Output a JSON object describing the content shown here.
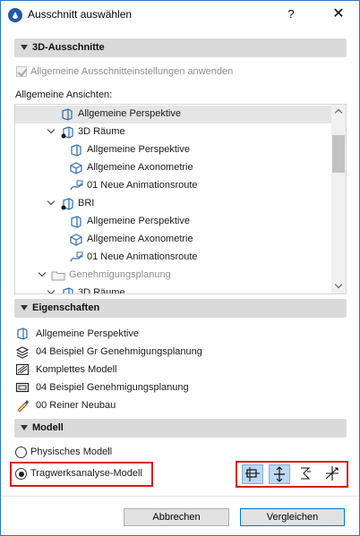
{
  "window": {
    "title": "Ausschnitt auswählen",
    "help_label": "?",
    "close_label": "✕"
  },
  "section_3d": {
    "label": "3D-Ausschnitte"
  },
  "apply_general": {
    "label": "Allgemeine Ausschnitteinstellungen anwenden",
    "checked": true,
    "disabled": true
  },
  "views_label": "Allgemeine Ansichten:",
  "tree": [
    {
      "label": "Allgemeine Perspektive",
      "icon": "perspective-icon",
      "selected": true
    },
    {
      "label": "3D Räume",
      "icon": "folder-3d-icon",
      "expanded": true
    },
    {
      "label": "Allgemeine Perspektive",
      "icon": "perspective-icon"
    },
    {
      "label": "Allgemeine Axonometrie",
      "icon": "axonometry-icon"
    },
    {
      "label": "01 Neue Animationsroute",
      "icon": "animation-route-icon"
    },
    {
      "label": "BRI",
      "icon": "folder-3d-icon",
      "expanded": true
    },
    {
      "label": "Allgemeine Perspektive",
      "icon": "perspective-icon"
    },
    {
      "label": "Allgemeine Axonometrie",
      "icon": "axonometry-icon"
    },
    {
      "label": "01 Neue Animationsroute",
      "icon": "animation-route-icon"
    },
    {
      "label": "Genehmigungsplanung",
      "icon": "folder-icon",
      "expanded": true,
      "dim": true
    },
    {
      "label": "3D Räume",
      "icon": "folder-3d-icon",
      "expanded": true
    }
  ],
  "section_props": {
    "label": "Eigenschaften"
  },
  "properties": [
    {
      "label": "Allgemeine Perspektive",
      "icon": "perspective-icon"
    },
    {
      "label": "04 Beispiel Gr Genehmigungsplanung",
      "icon": "layer-combination-icon"
    },
    {
      "label": "Komplettes Modell",
      "icon": "model-filter-icon"
    },
    {
      "label": "04 Beispiel Genehmigungsplanung",
      "icon": "pen-set-icon"
    },
    {
      "label": "00 Reiner Neubau",
      "icon": "renovation-filter-icon"
    }
  ],
  "section_model": {
    "label": "Modell"
  },
  "model_options": [
    {
      "label": "Physisches Modell",
      "selected": false
    },
    {
      "label": "Tragwerksanalyse-Modell",
      "selected": true
    }
  ],
  "analytical_tools": [
    {
      "icon": "structural-surface-icon",
      "active": true
    },
    {
      "icon": "structural-axis-icon",
      "active": true
    },
    {
      "icon": "structural-link-icon",
      "active": false
    },
    {
      "icon": "structural-support-icon",
      "active": false
    }
  ],
  "buttons": {
    "cancel": "Abbrechen",
    "compare": "Vergleichen"
  },
  "colors": {
    "highlight": "#e0101a",
    "accent": "#0078d7",
    "section_bg": "#dadada"
  }
}
